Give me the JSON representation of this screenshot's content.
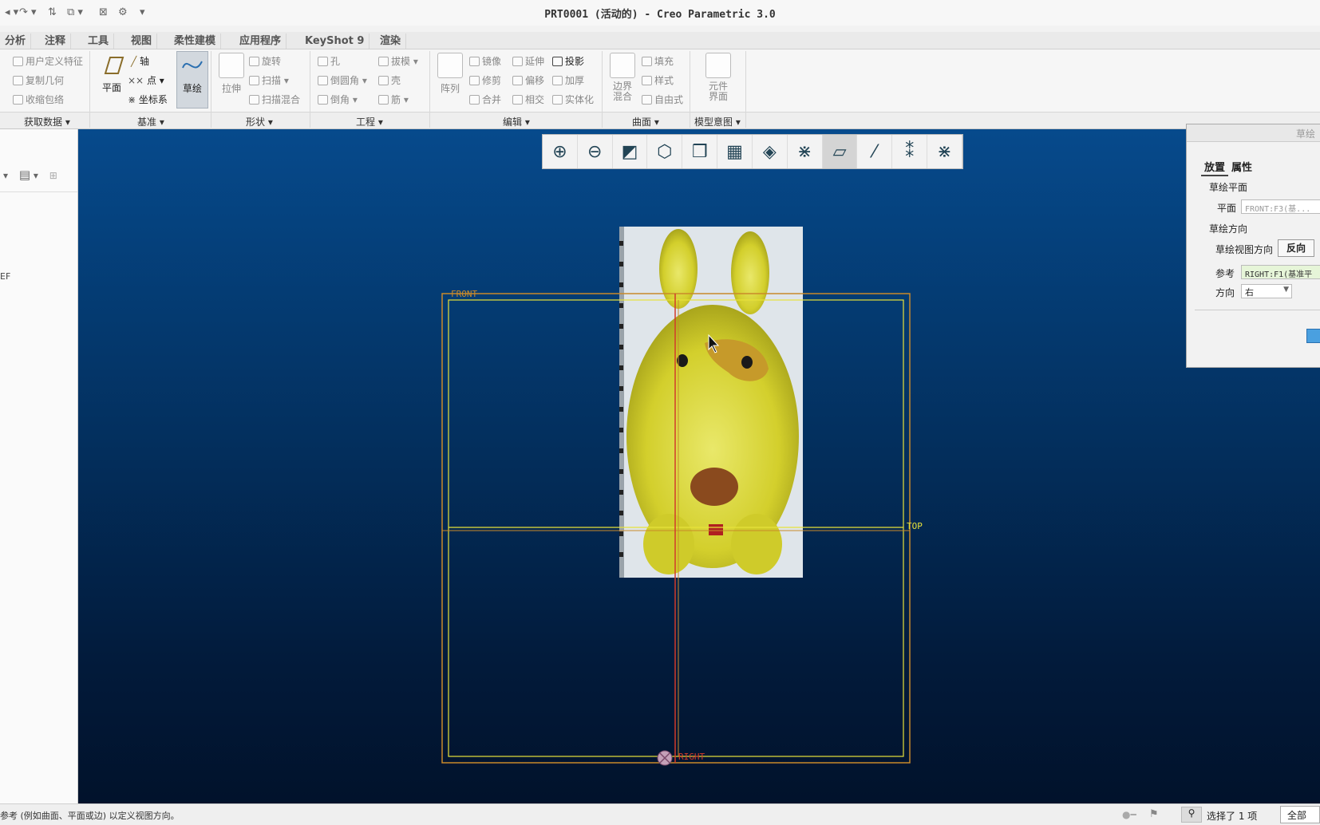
{
  "title": "PRT0001 (活动的) - Creo Parametric 3.0",
  "tabs": [
    "分析",
    "注释",
    "工具",
    "视图",
    "柔性建模",
    "应用程序",
    "KeyShot 9",
    "渲染"
  ],
  "ribbon": {
    "getdata": {
      "items": [
        "用户定义特征",
        "复制几何",
        "收缩包络"
      ],
      "group": "获取数据"
    },
    "datum": {
      "plane": "平面",
      "axis": "轴",
      "point": "点",
      "csys": "坐标系",
      "sketch": "草绘",
      "group": "基准"
    },
    "shapes": {
      "extrude": "拉伸",
      "revolve": "旋转",
      "sweep": "扫描",
      "swept_blend": "扫描混合",
      "group": "形状"
    },
    "engineering": {
      "hole": "孔",
      "round": "倒圆角",
      "chamfer": "倒角",
      "draft": "拔模",
      "shell": "壳",
      "rib": "筋",
      "group": "工程"
    },
    "editing": {
      "pattern": "阵列",
      "mirror": "镜像",
      "trim": "修剪",
      "merge": "合并",
      "extend": "延伸",
      "offset": "偏移",
      "intersect": "相交",
      "project": "投影",
      "thicken": "加厚",
      "solidify": "实体化",
      "group": "编辑"
    },
    "surfaces": {
      "fill": "填充",
      "style": "样式",
      "freestyle": "自由式",
      "boundary": "边界混合",
      "group": "曲面"
    },
    "model_intent": {
      "component_interface": "元件界面",
      "group": "模型意图"
    }
  },
  "left_panel": {
    "partial_label": "EF"
  },
  "datum_labels": {
    "front": "FRONT",
    "top": "TOP",
    "right": "RIGHT"
  },
  "dialog": {
    "title": "草绘",
    "tabs": [
      "放置",
      "属性"
    ],
    "sketch_plane_label": "草绘平面",
    "plane_label": "平面",
    "plane_value": "FRONT:F3(基...",
    "orientation_label": "草绘方向",
    "view_direction_label": "草绘视图方向",
    "flip_button": "反向",
    "reference_label": "参考",
    "reference_value": "RIGHT:F1(基准平",
    "direction_label": "方向",
    "direction_value": "右"
  },
  "status": {
    "message": "参考 (例如曲面、平面或边) 以定义视图方向。",
    "selected": "选择了 1 项",
    "filter": "全部"
  },
  "colors": {
    "viewport_top": "#064a8c",
    "viewport_bottom": "#01122b",
    "datum_yellow": "#e8e23a",
    "datum_orange": "#c98a2a",
    "datum_red": "#d23a2a"
  }
}
